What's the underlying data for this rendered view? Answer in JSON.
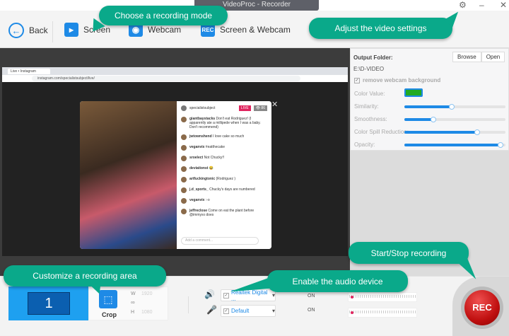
{
  "window": {
    "title": "VideoProc - Recorder"
  },
  "toolbar": {
    "back": "Back",
    "modes": [
      {
        "label": "Screen"
      },
      {
        "label": "Webcam"
      },
      {
        "label": "Screen & Webcam",
        "icon_text": "REC"
      }
    ]
  },
  "callouts": {
    "mode": "Choose a recording mode",
    "settings": "Adjust the video settings",
    "area": "Customize a recording area",
    "audio": "Enable the audio device",
    "rec": "Start/Stop recording"
  },
  "preview": {
    "browser_tab": "Live • Instagram",
    "url": "instagram.com/specialistsubject/live/",
    "ig_user": "specialistsubject",
    "live_badge": "LIVE",
    "viewers": "👁 86",
    "comments": [
      {
        "user": "giantbaystacks",
        "text": "Don't eat Rodriguez! (I apparently ate a millipede when I was a baby. Don't recommend)"
      },
      {
        "user": "jwtownshend",
        "text": "I love cake so much"
      },
      {
        "user": "veganvix",
        "text": "#eatthecake"
      },
      {
        "user": "sroelect",
        "text": "Not Chucky!!"
      },
      {
        "user": "deviationst",
        "text": "😂"
      },
      {
        "user": "artfuckingtonic",
        "text": "(Rodriguez )"
      },
      {
        "user": "j.d_sports_",
        "text": "Chucky's days are numbered"
      },
      {
        "user": "veganvix",
        "text": ":-o"
      },
      {
        "user": "jeffreclose",
        "text": "Come on eat the plant before @immyxx does"
      }
    ],
    "comment_placeholder": "Add a comment..."
  },
  "settings": {
    "output_label": "Output Folder:",
    "browse": "Browse",
    "open": "Open",
    "path": "E:\\D-VIDEO",
    "remove_bg": "remove webcam background",
    "color_label": "Color Value:",
    "color": "#22aa22",
    "sliders": [
      {
        "label": "Similarity:",
        "value": 0.47
      },
      {
        "label": "Smoothness:",
        "value": 0.29
      },
      {
        "label": "Color Spill Reduction:",
        "value": 0.72
      },
      {
        "label": "Opacity:",
        "value": 0.95
      }
    ]
  },
  "bottom": {
    "screen_number": "1",
    "crop": "Crop",
    "w_label": "W",
    "w": "1920",
    "h_label": "H",
    "h": "1080",
    "speaker_device": "Realtek Digital ...",
    "mic_device": "Default",
    "speaker_state": "ON",
    "mic_state": "ON",
    "rec": "REC"
  }
}
